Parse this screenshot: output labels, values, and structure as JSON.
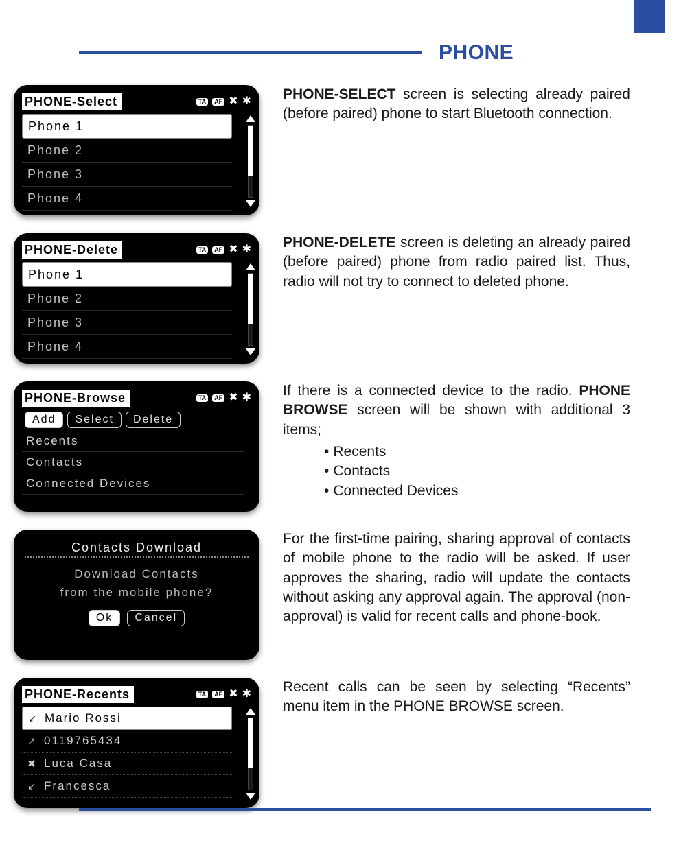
{
  "page_title": "PHONE",
  "icons": {
    "ta": "TA",
    "af": "AF"
  },
  "screens": {
    "select": {
      "title": "PHONE-Select",
      "items": [
        "Phone 1",
        "Phone 2",
        "Phone 3",
        "Phone 4"
      ]
    },
    "delete": {
      "title": "PHONE-Delete",
      "items": [
        "Phone 1",
        "Phone 2",
        "Phone 3",
        "Phone 4"
      ]
    },
    "browse": {
      "title": "PHONE-Browse",
      "buttons": [
        "Add",
        "Select",
        "Delete"
      ],
      "items": [
        "Recents",
        "Contacts",
        "Connected Devices"
      ]
    },
    "download": {
      "title": "Contacts Download",
      "line1": "Download Contacts",
      "line2": "from the mobile phone?",
      "ok": "Ok",
      "cancel": "Cancel"
    },
    "recents": {
      "title": "PHONE-Recents",
      "items": [
        {
          "icon": "in",
          "label": "Mario Rossi"
        },
        {
          "icon": "out",
          "label": "0119765434"
        },
        {
          "icon": "miss",
          "label": "Luca Casa"
        },
        {
          "icon": "in",
          "label": "Francesca"
        }
      ]
    }
  },
  "text": {
    "select": {
      "bold": "PHONE-SELECT",
      "rest": " screen is selecting already paired (before paired) phone to start Bluetooth connection."
    },
    "delete": {
      "bold": "PHONE-DELETE",
      "rest": " screen is deleting an already paired (before paired) phone from radio paired list. Thus, radio will not try to connect to deleted phone."
    },
    "browse": {
      "pre": "If there is a connected device to the radio. ",
      "bold": "PHONE BROWSE",
      "post": " screen will be shown with additional 3 items;",
      "bullets": [
        "Recents",
        "Contacts",
        "Connected Devices"
      ]
    },
    "download": "For the first-time pairing, sharing approval of contacts of mobile phone to the radio will be asked. If user approves the sharing, radio will update the contacts without asking any approval again. The approval (non-approval) is valid for recent calls and phone-book.",
    "recents": "Recent calls can be seen by selecting “Recents” menu item in the PHONE BROWSE screen."
  }
}
